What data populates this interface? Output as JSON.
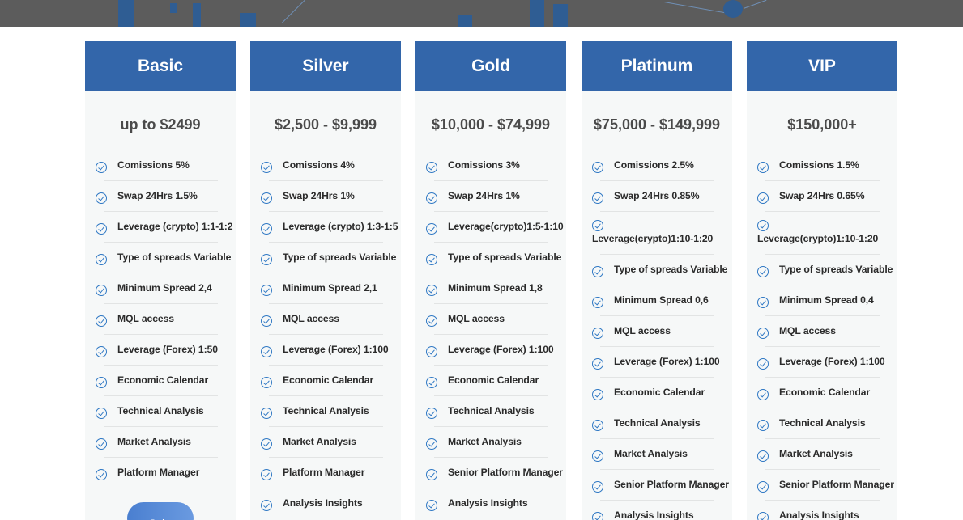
{
  "plans": [
    {
      "name": "Basic",
      "price": "up to $2499",
      "features": [
        "Comissions 5%",
        "Swap 24Hrs 1.5%",
        "Leverage (crypto) 1:1-1:2",
        "Type of spreads Variable",
        "Minimum Spread 2,4",
        "MQL access",
        "Leverage (Forex) 1:50",
        "Economic Calendar",
        "Technical Analysis",
        "Market Analysis",
        "Platform Manager"
      ],
      "join_label": "Join"
    },
    {
      "name": "Silver",
      "price": "$2,500 - $9,999",
      "features": [
        "Comissions 4%",
        "Swap 24Hrs 1%",
        "Leverage (crypto) 1:3-1:5",
        "Type of spreads Variable",
        "Minimum Spread 2,1",
        "MQL access",
        "Leverage (Forex) 1:100",
        "Economic Calendar",
        "Technical Analysis",
        "Market Analysis",
        "Platform Manager",
        "Analysis Insights"
      ]
    },
    {
      "name": "Gold",
      "price": "$10,000 - $74,999",
      "features": [
        "Comissions 3%",
        "Swap 24Hrs 1%",
        "Leverage(crypto)1:5-1:10",
        "Type of spreads Variable",
        "Minimum Spread 1,8",
        "MQL access",
        "Leverage (Forex) 1:100",
        "Economic Calendar",
        "Technical Analysis",
        "Market Analysis",
        "Senior Platform Manager",
        "Analysis Insights"
      ]
    },
    {
      "name": "Platinum",
      "price": "$75,000 - $149,999",
      "features": [
        "Comissions 2.5%",
        "Swap 24Hrs 0.85%",
        "Leverage(crypto)1:10-1:20",
        "Type of spreads Variable",
        "Minimum Spread 0,6",
        "MQL access",
        "Leverage (Forex) 1:100",
        "Economic Calendar",
        "Technical Analysis",
        "Market Analysis",
        "Senior Platform Manager",
        "Analysis Insights"
      ]
    },
    {
      "name": "VIP",
      "price": "$150,000+",
      "features": [
        "Comissions 1.5%",
        "Swap 24Hrs 0.65%",
        "Leverage(crypto)1:10-1:20",
        "Type of spreads Variable",
        "Minimum Spread 0,4",
        "MQL access",
        "Leverage (Forex) 1:100",
        "Economic Calendar",
        "Technical Analysis",
        "Market Analysis",
        "Senior Platform Manager",
        "Analysis Insights"
      ]
    }
  ],
  "colors": {
    "header": "#3366aa",
    "check": "#2f78c4",
    "card": "#f6f8f8"
  },
  "icons": {
    "feature": "check-circle-icon"
  }
}
